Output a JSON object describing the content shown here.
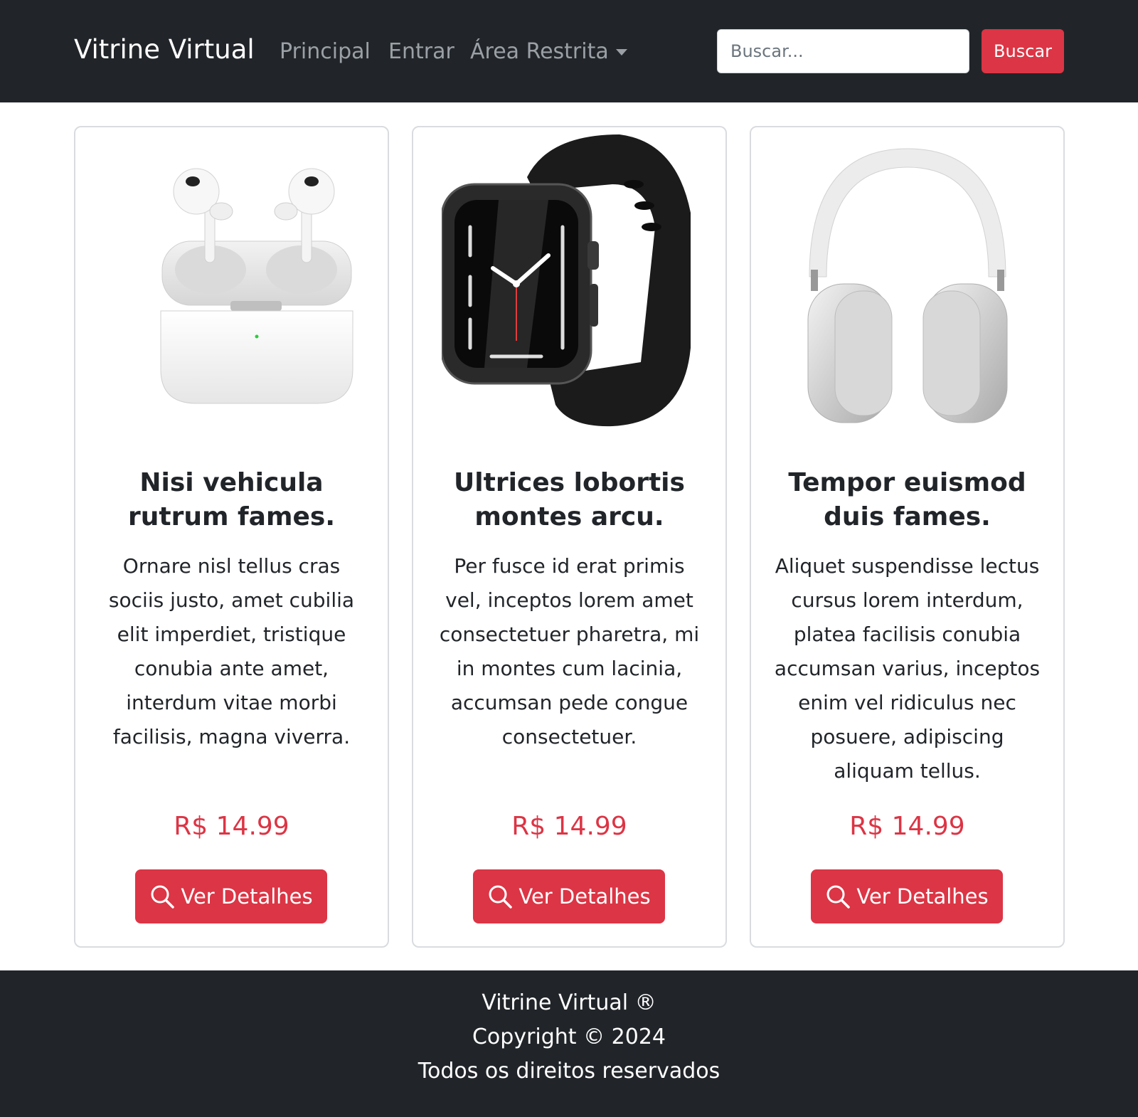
{
  "navbar": {
    "brand": "Vitrine Virtual",
    "links": [
      "Principal",
      "Entrar",
      "Área Restrita"
    ],
    "search_placeholder": "Buscar...",
    "search_button": "Buscar"
  },
  "products": [
    {
      "image": "airpods-pro-image",
      "title": "Nisi vehicula rutrum fames.",
      "description": "Ornare nisl tellus cras sociis justo, amet cubilia elit imperdiet, tristique conubia ante amet, interdum vitae morbi facilisis, magna viverra.",
      "price": "R$ 14.99",
      "button": "Ver Detalhes"
    },
    {
      "image": "apple-watch-image",
      "title": "Ultrices lobortis montes arcu.",
      "description": "Per fusce id erat primis vel, inceptos lorem amet consectetuer pharetra, mi in montes cum lacinia, accumsan pede congue consectetuer.",
      "price": "R$ 14.99",
      "button": "Ver Detalhes"
    },
    {
      "image": "airpods-max-image",
      "title": "Tempor euismod duis fames.",
      "description": "Aliquet suspendisse lectus cursus lorem interdum, platea facilisis conubia accumsan varius, inceptos enim vel ridiculus nec posuere, adipiscing aliquam tellus.",
      "price": "R$ 14.99",
      "button": "Ver Detalhes"
    }
  ],
  "footer": {
    "line1": "Vitrine Virtual  ®",
    "line2": "Copyright © 2024",
    "line3": "Todos os direitos reservados"
  },
  "colors": {
    "navbar_bg": "#212529",
    "accent": "#dc3545",
    "nav_link": "#9aa0a6"
  }
}
